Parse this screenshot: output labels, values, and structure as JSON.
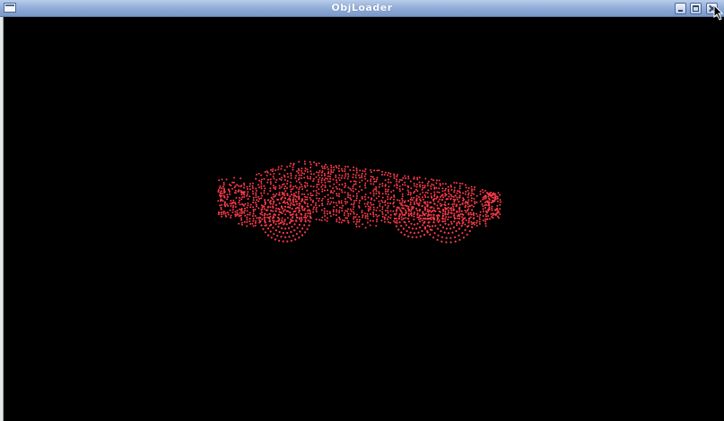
{
  "window": {
    "title": "ObjLoader"
  },
  "titlebar": {
    "menu_icon": "window-menu-icon",
    "buttons": [
      "minimize",
      "maximize",
      "close"
    ]
  },
  "viewport": {
    "background": "#000000",
    "point_color": "#ff3b4a",
    "render_mode": "point-cloud"
  }
}
